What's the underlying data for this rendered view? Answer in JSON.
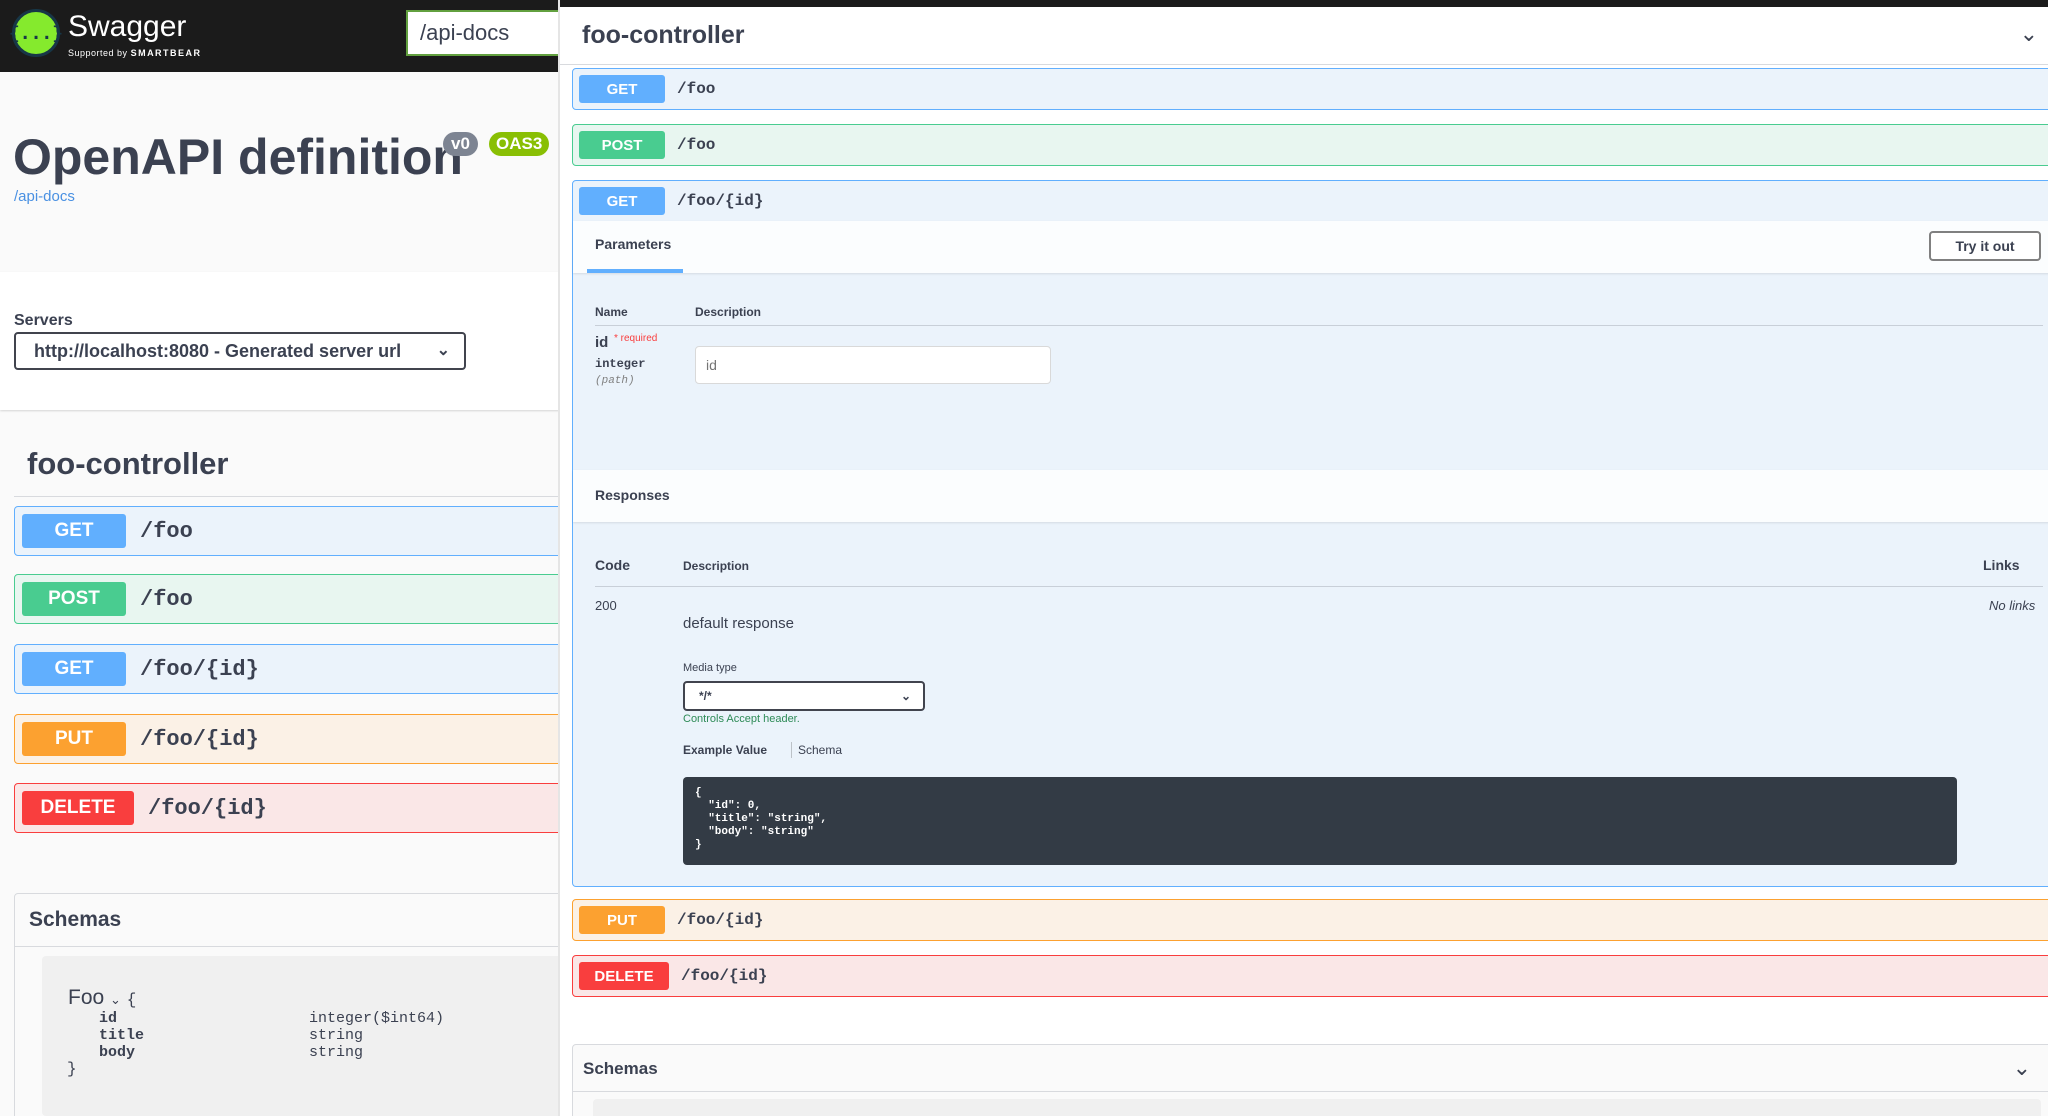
{
  "topbar": {
    "logo_glyph": "{...}",
    "logo_title": "Swagger",
    "logo_sub_prefix": "Supported by",
    "logo_sub_brand": "SMARTBEAR",
    "url_value": "/api-docs"
  },
  "info": {
    "title": "OpenAPI definition",
    "version": "v0",
    "oas": "OAS3",
    "link": "/api-docs"
  },
  "servers": {
    "label": "Servers",
    "selected": "http://localhost:8080 - Generated server url"
  },
  "controller": {
    "name": "foo-controller"
  },
  "operations": [
    {
      "method": "GET",
      "path": "/foo"
    },
    {
      "method": "POST",
      "path": "/foo"
    },
    {
      "method": "GET",
      "path": "/foo/{id}"
    },
    {
      "method": "PUT",
      "path": "/foo/{id}"
    },
    {
      "method": "DELETE",
      "path": "/foo/{id}"
    }
  ],
  "expanded": {
    "params_tab": "Parameters",
    "try_button": "Try it out",
    "col_name": "Name",
    "col_description": "Description",
    "param": {
      "name": "id",
      "required": "* required",
      "type": "integer",
      "in": "(path)",
      "placeholder": "id"
    },
    "responses_title": "Responses",
    "resp_col_code": "Code",
    "resp_col_description": "Description",
    "resp_col_links": "Links",
    "response": {
      "code": "200",
      "description": "default response",
      "links": "No links",
      "media_label": "Media type",
      "media_selected": "*/*",
      "media_note": "Controls Accept header.",
      "example_tab": "Example Value",
      "schema_tab": "Schema",
      "example_code": "{\n  \"id\": 0,\n  \"title\": \"string\",\n  \"body\": \"string\"\n}"
    }
  },
  "schemas": {
    "title": "Schemas",
    "model": {
      "name": "Foo",
      "open_brace": "{",
      "close_brace": "}",
      "properties": [
        {
          "name": "id",
          "type": "integer($int64)"
        },
        {
          "name": "title",
          "type": "string"
        },
        {
          "name": "body",
          "type": "string"
        }
      ]
    }
  },
  "colors": {
    "get": "#61affe",
    "post": "#49cc90",
    "put": "#fca130",
    "delete": "#f93e3e",
    "topbar": "#1b1b1b",
    "accent_green": "#85ea2d"
  },
  "icons": {
    "chevron_down": "⌄",
    "chevron_small": "⌄"
  }
}
